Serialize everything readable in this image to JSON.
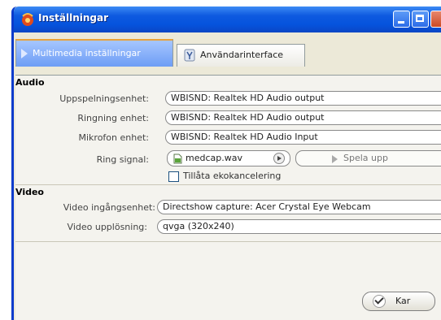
{
  "window": {
    "title": "Inställningar"
  },
  "tabs": [
    {
      "label": "Multimedia inställningar",
      "active": true
    },
    {
      "label": "Användarinterface",
      "active": false
    }
  ],
  "audio": {
    "title": "Audio",
    "playback_label": "Uppspelningsenhet:",
    "playback_value": "WBISND: Realtek HD Audio output",
    "ring_label": "Ringning enhet:",
    "ring_value": "WBISND: Realtek HD Audio output",
    "mic_label": "Mikrofon enhet:",
    "mic_value": "WBISND: Realtek HD Audio Input",
    "signal_label": "Ring signal:",
    "signal_file": "medcap.wav",
    "play_label": "Spela upp",
    "echo_label": "Tillåta ekokancelering",
    "echo_checked": false
  },
  "video": {
    "title": "Video",
    "input_label": "Video ingångsenhet:",
    "input_value": "Directshow capture: Acer Crystal Eye Webcam",
    "resolution_label": "Video upplösning:",
    "resolution_value": "qvga (320x240)"
  },
  "buttons": {
    "ok_label": "Kar"
  },
  "colors": {
    "titlebar": "#0553dd",
    "tab_active": "#6d9df5",
    "panel": "#f4f3ee"
  },
  "icons": {
    "app": "app-icon",
    "file": "wav-file-icon",
    "interface": "interface-icon",
    "check": "checkmark-icon"
  }
}
